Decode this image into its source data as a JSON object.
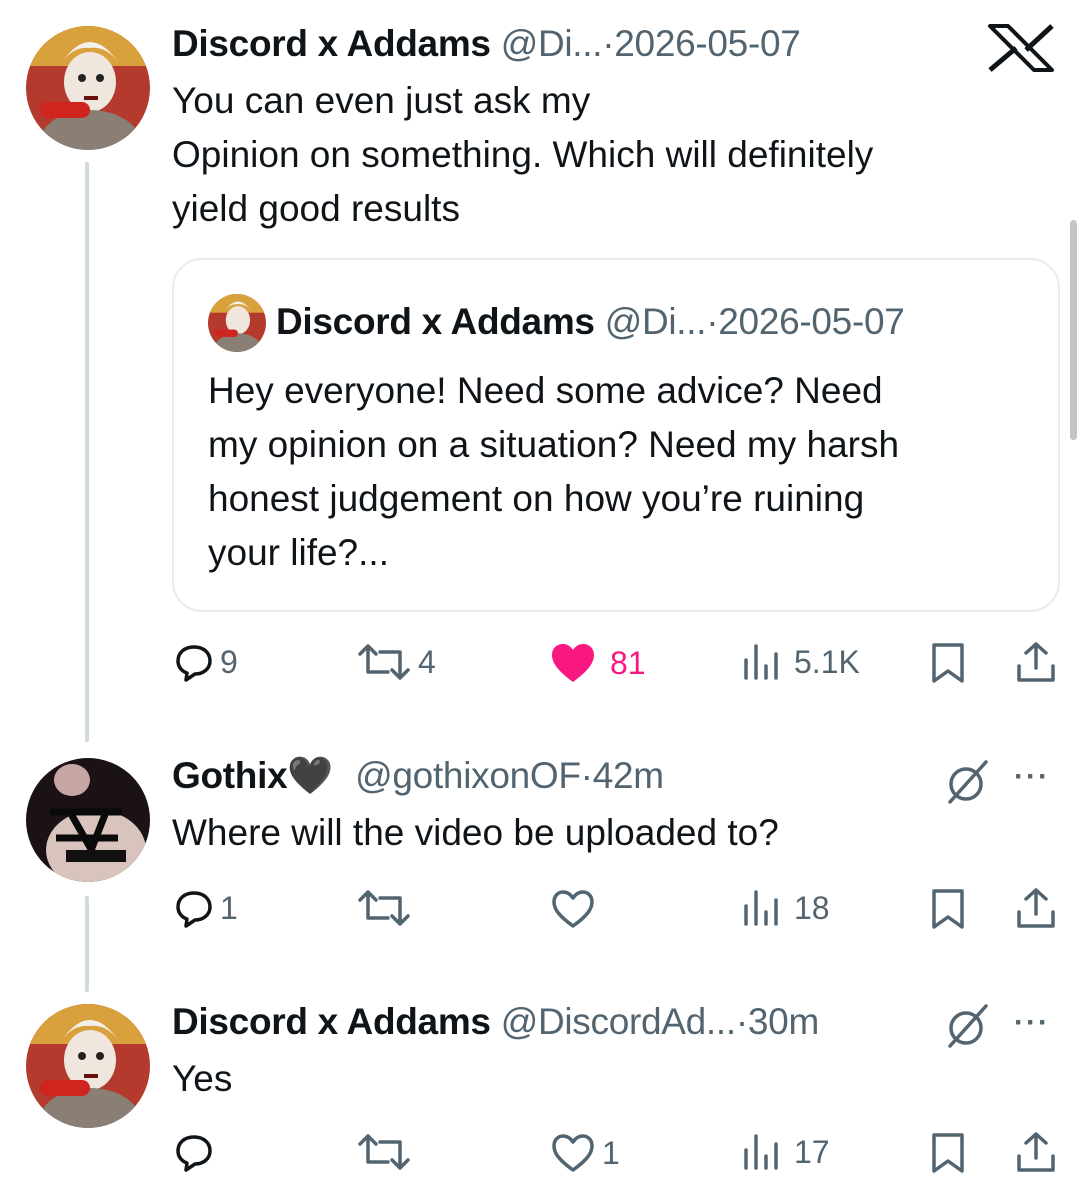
{
  "app": {
    "logo_icon": "x-logo-icon"
  },
  "tweets": [
    {
      "name": "Discord x Addams",
      "handle": "@Di...",
      "sep": "·",
      "time": "2026-05-07",
      "text_lines": [
        "You can even just ask my",
        "Opinion on something. Which will definitely",
        "yield good results"
      ],
      "quote": {
        "name": "Discord x Addams",
        "handle": "@Di...",
        "sep": "·",
        "time": "2026-05-07",
        "text_lines": [
          "Hey everyone!  Need some advice? Need",
          "my opinion on a situation? Need my harsh",
          "honest judgement on how you’re ruining",
          "your life?..."
        ]
      },
      "actions": {
        "replies": "9",
        "reposts": "4",
        "likes": "81",
        "views": "5.1K"
      },
      "liked": true
    },
    {
      "name": "Gothix",
      "name_suffix": "🖤",
      "handle": "@gothixonOF",
      "sep": "·",
      "time": "42m",
      "text_lines": [
        "Where will the video be uploaded to?"
      ],
      "actions": {
        "replies": "1",
        "reposts": "",
        "likes": "",
        "views": "18"
      },
      "liked": false
    },
    {
      "name": "Discord x Addams",
      "handle": "@DiscordAd...",
      "sep": "·",
      "time": "30m",
      "text_lines": [
        "Yes"
      ],
      "actions": {
        "replies": "",
        "reposts": "",
        "likes": "1",
        "views": "17"
      },
      "liked": false
    }
  ],
  "more_label": "···",
  "colors": {
    "like_active": "#f91880",
    "muted": "#536471",
    "text": "#0f1419",
    "thread_line": "#cfd9de"
  }
}
